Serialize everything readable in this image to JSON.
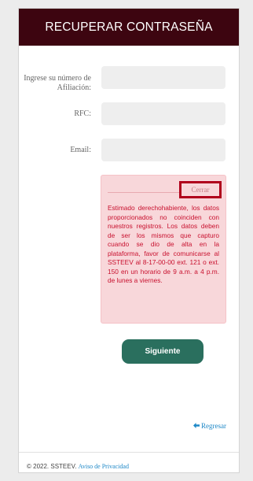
{
  "header": {
    "title": "RECUPERAR CONTRASEÑA"
  },
  "form": {
    "afiliacion_label": "Ingrese su número de Afiliación:",
    "afiliacion_value": "",
    "rfc_label": "RFC:",
    "rfc_value": "",
    "email_label": "Email:",
    "email_value": ""
  },
  "alert": {
    "close_label": "Cerrar",
    "message": "Estimado derechohabiente, los datos proporcionados no coinciden con nuestros registros. Los datos deben de ser los mismos que capturo cuando se dio de alta en la plataforma, favor de comunicarse al SSTEEV al 8-17-00-00 ext. 121 o ext. 150 en un horario de 9 a.m. a 4 p.m. de lunes a viernes."
  },
  "actions": {
    "next_label": "Siguiente",
    "back_label": "Regresar",
    "back_icon": "arrow-left-icon"
  },
  "footer": {
    "copyright": "© 2022. SSTEEV.",
    "privacy_label": "Aviso de Privacidad"
  },
  "colors": {
    "header_bg": "#3d0510",
    "alert_bg": "#f8d7da",
    "alert_text": "#c8102e",
    "highlight_border": "#b0001c",
    "button_bg": "#2a6f5e",
    "link": "#1e88c7"
  }
}
